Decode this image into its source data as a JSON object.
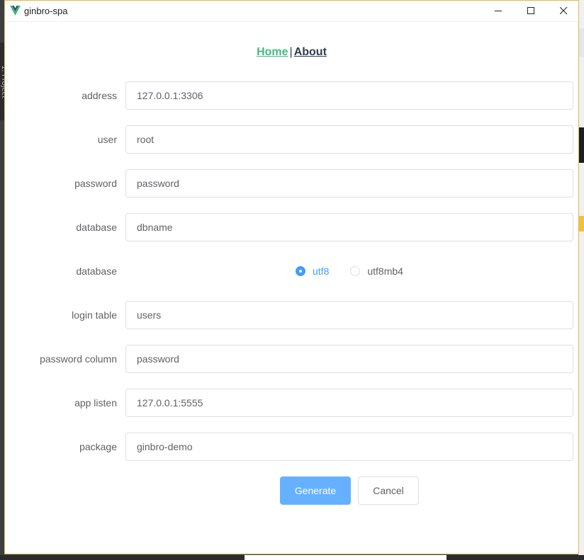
{
  "window": {
    "title": "ginbro-spa"
  },
  "background": {
    "side_text": "1: Project"
  },
  "nav": {
    "home": "Home",
    "separator": "|",
    "about": "About"
  },
  "form": {
    "address": {
      "label": "address",
      "value": "127.0.0.1:3306"
    },
    "user": {
      "label": "user",
      "value": "root"
    },
    "password": {
      "label": "password",
      "value": "password"
    },
    "database": {
      "label": "database",
      "value": "dbname"
    },
    "charset": {
      "label": "database",
      "options": [
        {
          "label": "utf8",
          "checked": true
        },
        {
          "label": "utf8mb4",
          "checked": false
        }
      ]
    },
    "login_table": {
      "label": "login table",
      "value": "users"
    },
    "password_column": {
      "label": "password column",
      "value": "password"
    },
    "app_listen": {
      "label": "app listen",
      "value": "127.0.0.1:5555"
    },
    "package": {
      "label": "package",
      "value": "ginbro-demo"
    }
  },
  "buttons": {
    "generate": "Generate",
    "cancel": "Cancel"
  },
  "colors": {
    "accent": "#409eff",
    "primary_button": "#66b1ff",
    "nav_home": "#42b983",
    "nav_about": "#2c3e50",
    "window_border": "#e6b84a"
  }
}
